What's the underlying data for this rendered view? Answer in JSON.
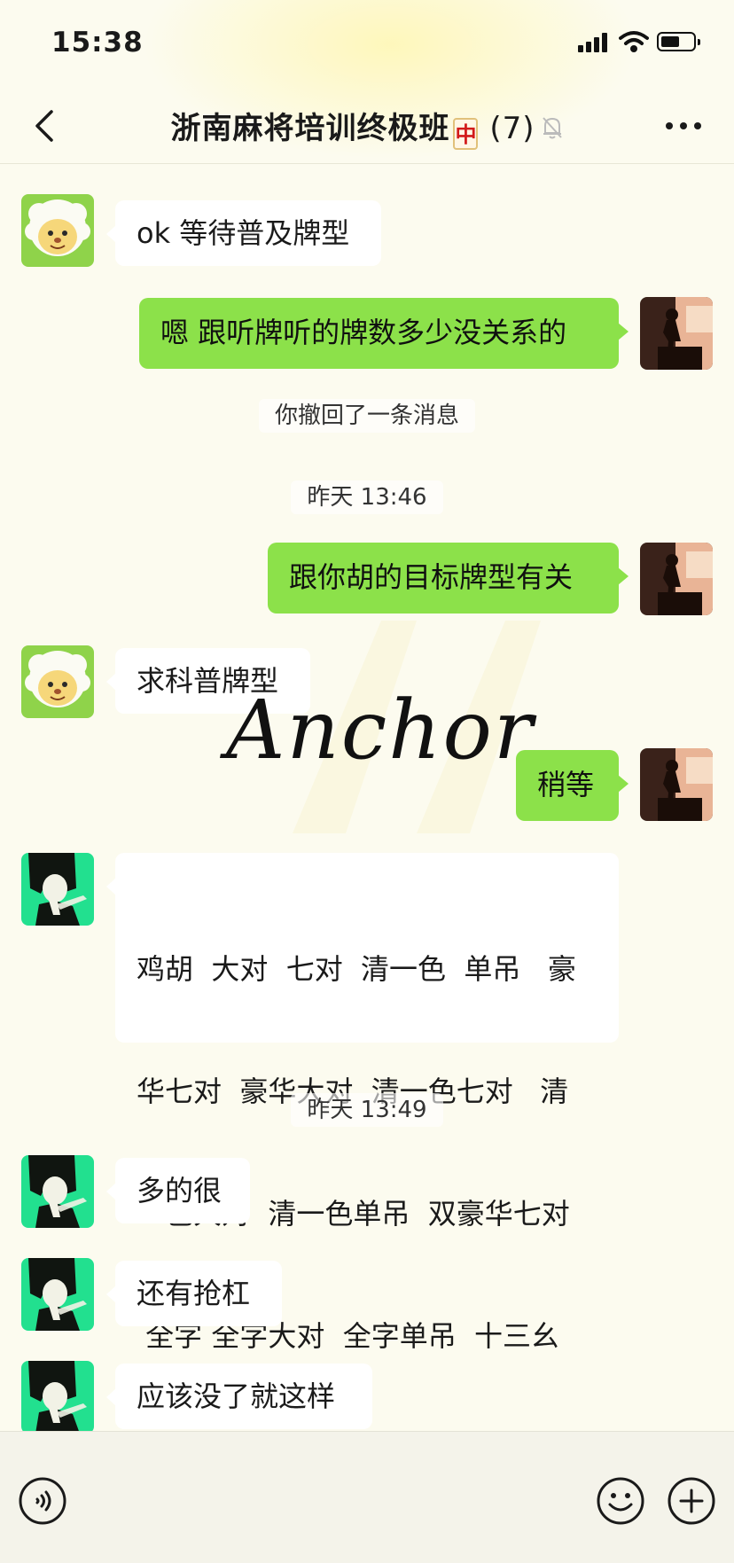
{
  "status_bar": {
    "time": "15:38"
  },
  "header": {
    "title": "浙南麻将培训终极班",
    "tile_glyph": "中",
    "member_count": "(7)"
  },
  "messages": [
    {
      "side": "in",
      "avatar": "sheep-avatar",
      "text": "ok 等待普及牌型"
    },
    {
      "side": "out",
      "avatar": "silhouette-avatar",
      "text": "嗯 跟听牌听的牌数多少没关系的"
    },
    {
      "type": "system",
      "text": "你撤回了一条消息"
    },
    {
      "type": "time",
      "text": "昨天 13:46"
    },
    {
      "side": "out",
      "avatar": "silhouette-avatar",
      "text": "跟你胡的目标牌型有关"
    },
    {
      "side": "in",
      "avatar": "sheep-avatar",
      "text": "求科普牌型"
    },
    {
      "side": "out",
      "avatar": "silhouette-avatar",
      "text": "稍等"
    },
    {
      "side": "in",
      "avatar": "anime-avatar",
      "lines": [
        "鸡胡  大对  七对  清一色  单吊   豪",
        "华七对  豪华大对  清一色七对   清",
        "一色大对  清一色单吊  双豪华七对",
        " 全字 全字大对  全字单吊  十三幺"
      ]
    },
    {
      "type": "time",
      "text": "昨天 13:49"
    },
    {
      "side": "in",
      "avatar": "anime-avatar",
      "text": "多的很"
    },
    {
      "side": "in",
      "avatar": "anime-avatar",
      "text": "还有抢杠"
    },
    {
      "side": "in",
      "avatar": "anime-avatar",
      "text": "应该没了就这样"
    }
  ],
  "watermark": "Anchor",
  "colors": {
    "background": "#fcfbef",
    "outgoing_bubble": "#8ce14a",
    "incoming_bubble": "#ffffff"
  },
  "input_bar": {
    "icons": [
      "voice-icon",
      "emoji-icon",
      "plus-icon"
    ]
  }
}
